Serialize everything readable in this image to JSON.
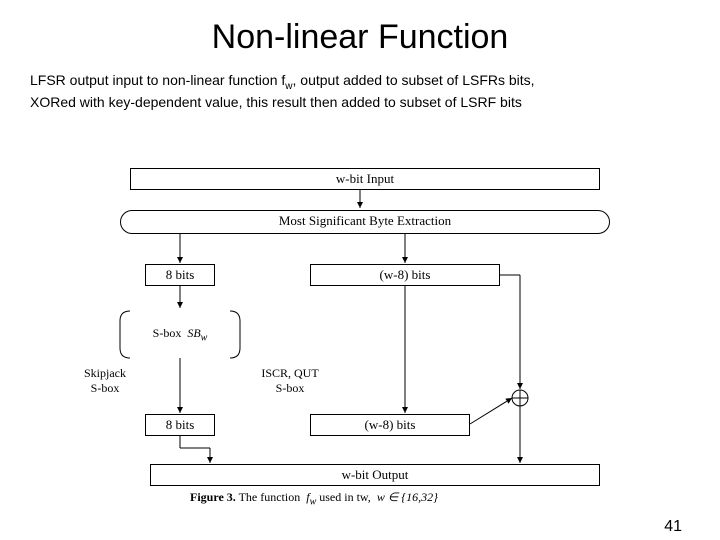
{
  "title": "Non-linear Function",
  "body": {
    "line1a": "LFSR output input to non-linear function f",
    "line1_sub": "w",
    "line1b": ", output added to subset of LSFRs bits,",
    "line2": "XORed with key-dependent value, this result then added to subset of LSRF bits"
  },
  "diagram": {
    "input_box": "w-bit Input",
    "msb_box": "Most Significant Byte Extraction",
    "bits8_a": "8 bits",
    "bits_wm8_a": "(w-8) bits",
    "sbox_label": "S-box",
    "sbox_sym": "SB",
    "sbox_sub": "w",
    "skipjack1": "Skipjack",
    "skipjack2": "S-box",
    "iscr1": "ISCR, QUT",
    "iscr2": "S-box",
    "bits8_b": "8 bits",
    "bits_wm8_b": "(w-8) bits",
    "output_box": "w-bit Output",
    "caption_a": "Figure 3.",
    "caption_b": "The function",
    "caption_c": "f",
    "caption_c_sub": "w",
    "caption_d": "used in tw,",
    "caption_e": "w ∈ {16,32}"
  },
  "page": "41"
}
